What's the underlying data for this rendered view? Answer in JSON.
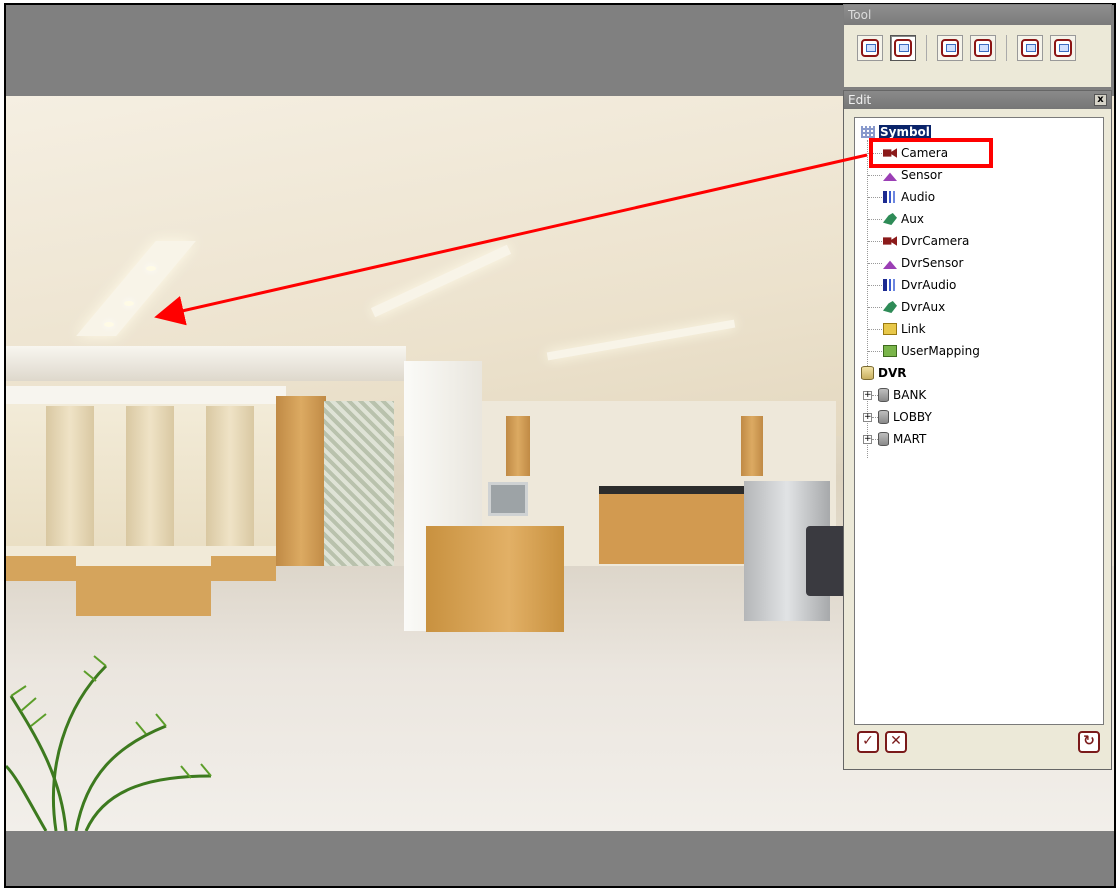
{
  "tool_window": {
    "title": "Tool",
    "buttons": [
      {
        "icon": "window-icon"
      },
      {
        "icon": "edit-pen-icon",
        "active": true
      },
      {
        "icon": "layout-icon"
      },
      {
        "icon": "edit-doc-icon"
      },
      {
        "icon": "copy-icon"
      },
      {
        "icon": "save-icon"
      }
    ]
  },
  "edit_window": {
    "title": "Edit",
    "close_label": "x",
    "tree": {
      "symbol_root": "Symbol",
      "symbols": [
        "Camera",
        "Sensor",
        "Audio",
        "Aux",
        "DvrCamera",
        "DvrSensor",
        "DvrAudio",
        "DvrAux",
        "Link",
        "UserMapping"
      ],
      "dvr_root": "DVR",
      "dvrs": [
        "BANK",
        "LOBBY",
        "MART"
      ]
    },
    "bottom_buttons": [
      "apply-icon",
      "delete-icon",
      "refresh-icon"
    ]
  },
  "annotation": {
    "highlight_target": "Camera",
    "highlight_color": "#ff0000"
  },
  "colors": {
    "background_gray": "#808080",
    "panel_bg": "#ece9d8",
    "selection": "#0a246a"
  }
}
